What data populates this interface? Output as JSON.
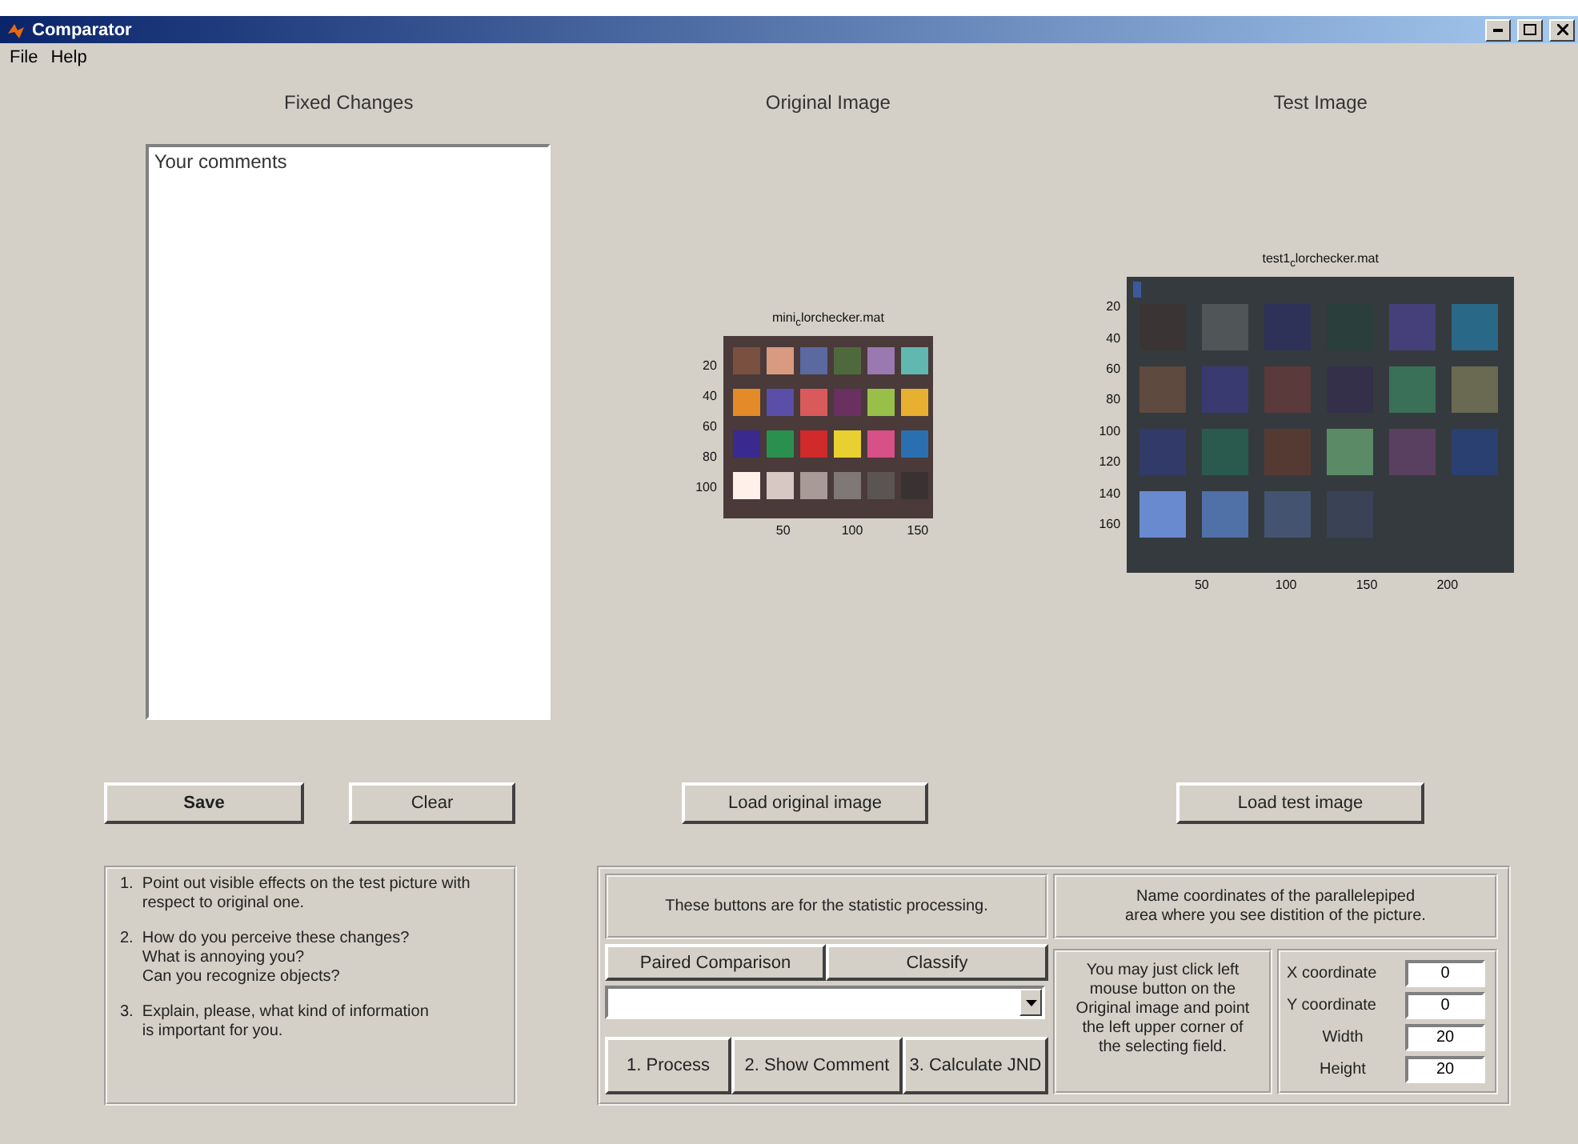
{
  "window": {
    "title": "Comparator"
  },
  "menu": [
    "File",
    "Help"
  ],
  "comments": {
    "heading": "Fixed Changes",
    "value": "Your comments",
    "buttons": [
      {
        "label": "Save",
        "kind": "bold"
      },
      {
        "label": "Clear",
        "kind": "plain"
      }
    ]
  },
  "images": [
    {
      "heading": "Original Image",
      "plot_title": "mini$_{c}$lorchecker.mat",
      "yticks": [
        "20",
        "40",
        "60",
        "80",
        "100"
      ],
      "xticks": [
        "50",
        "100",
        "150"
      ],
      "button": "Load original image"
    },
    {
      "heading": "Test Image",
      "plot_title": "test1$_{c}$lorchecker.mat",
      "yticks": [
        "20",
        "40",
        "60",
        "80",
        "100",
        "120",
        "140",
        "160"
      ],
      "xticks": [
        "50",
        "100",
        "150",
        "200"
      ],
      "button": "Load test image"
    }
  ],
  "instructions": [
    {
      "lines": [
        "1.  Point out visible effects on the test picture with",
        "     respect to original one."
      ]
    },
    {
      "lines": [
        "2.  How do you perceive these changes?",
        "     What is annoying you?",
        "     Can you recognize objects?"
      ]
    },
    {
      "lines": [
        "3.  Explain, please, what kind of information",
        "     is important for you."
      ]
    }
  ],
  "statistics": {
    "note": "These buttons  are for the statistic processing.",
    "method_buttons": [
      "Paired Comparison",
      "Classify"
    ],
    "steps": [
      "1. Process",
      "2. Show Comment",
      "3. Calculate JND"
    ]
  },
  "region": {
    "note_lines": [
      "Name coordinates of the parallelepiped",
      "area where you see distition of the picture."
    ],
    "hint_lines": [
      "You may just click left",
      "mouse button on the",
      "Original image and point",
      "the left upper corner of",
      "the selecting field."
    ],
    "fields": [
      {
        "label": "X coordinate",
        "value": "0"
      },
      {
        "label": "Y coordinate",
        "value": "0"
      },
      {
        "label": "Width",
        "value": "20"
      },
      {
        "label": "Height",
        "value": "20"
      }
    ]
  }
}
